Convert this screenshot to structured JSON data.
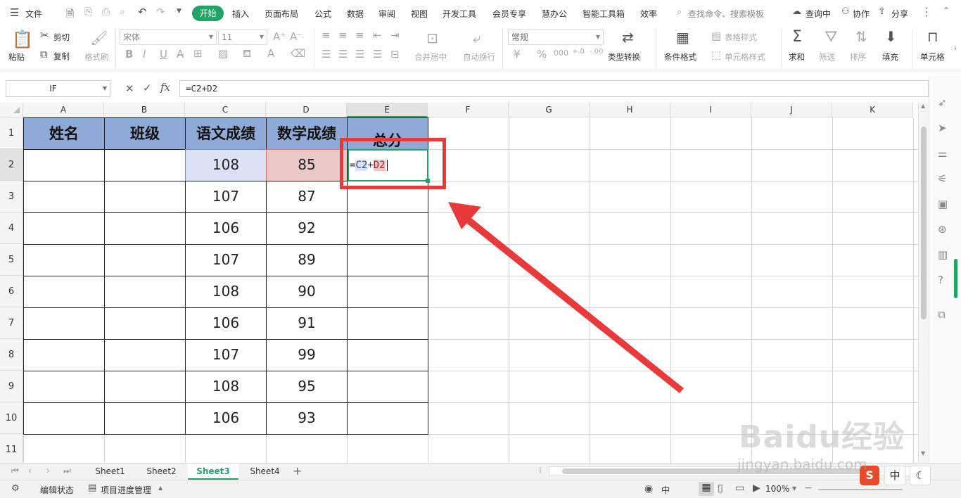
{
  "menubar": {
    "file": "文件",
    "tabs": [
      "开始",
      "插入",
      "页面布局",
      "公式",
      "数据",
      "审阅",
      "视图",
      "开发工具",
      "会员专享",
      "慧办公",
      "智能工具箱",
      "效率"
    ],
    "search_placeholder": "查找命令、搜索模板",
    "right": [
      "查询中",
      "协作",
      "分享"
    ]
  },
  "ribbon": {
    "paste": "粘贴",
    "cut": "剪切",
    "copy": "复制",
    "format_painter": "格式刷",
    "font_name": "宋体",
    "font_size": "11",
    "merge_center": "合并居中",
    "wrap_text": "自动换行",
    "number_format": "常规",
    "type_convert": "类型转换",
    "conditional_format": "条件格式",
    "table_style": "表格样式",
    "cell_style": "单元格样式",
    "sum": "求和",
    "filter": "筛选",
    "sort": "排序",
    "fill": "填充",
    "cell": "单元格"
  },
  "formula_bar": {
    "name_box": "IF",
    "formula": "=C2+D2",
    "fx": "fx"
  },
  "sheet": {
    "columns": [
      "A",
      "B",
      "C",
      "D",
      "E",
      "F",
      "G",
      "H",
      "I",
      "J",
      "K"
    ],
    "rows": [
      "1",
      "2",
      "3",
      "4",
      "5",
      "6",
      "7",
      "8",
      "9",
      "10",
      "11"
    ],
    "headers": [
      "姓名",
      "班级",
      "语文成绩",
      "数学成绩",
      "总分"
    ],
    "chinese": [
      "108",
      "107",
      "106",
      "107",
      "108",
      "106",
      "107",
      "108",
      "106"
    ],
    "math": [
      "85",
      "87",
      "92",
      "89",
      "90",
      "91",
      "99",
      "95",
      "93"
    ],
    "editing_formula": {
      "eq": "=",
      "ref1": "C2",
      "plus": "+",
      "ref2": "D2"
    }
  },
  "tabs": {
    "sheets": [
      "Sheet1",
      "Sheet2",
      "Sheet3",
      "Sheet4"
    ],
    "active": "Sheet3"
  },
  "status": {
    "edit_state": "编辑状态",
    "project": "项目进度管理",
    "zoom": "100%",
    "lang": "中"
  },
  "watermark": {
    "brand": "Baidu经验",
    "url": "jingyan.baidu.com"
  },
  "ime": {
    "s": "S",
    "zh": "中"
  },
  "colors": {
    "accent": "#21a366",
    "header_fill": "#8faad6",
    "c2_fill": "#dbe2f6",
    "d2_fill": "#ecc7c7",
    "annotation": "#e83a3a"
  }
}
